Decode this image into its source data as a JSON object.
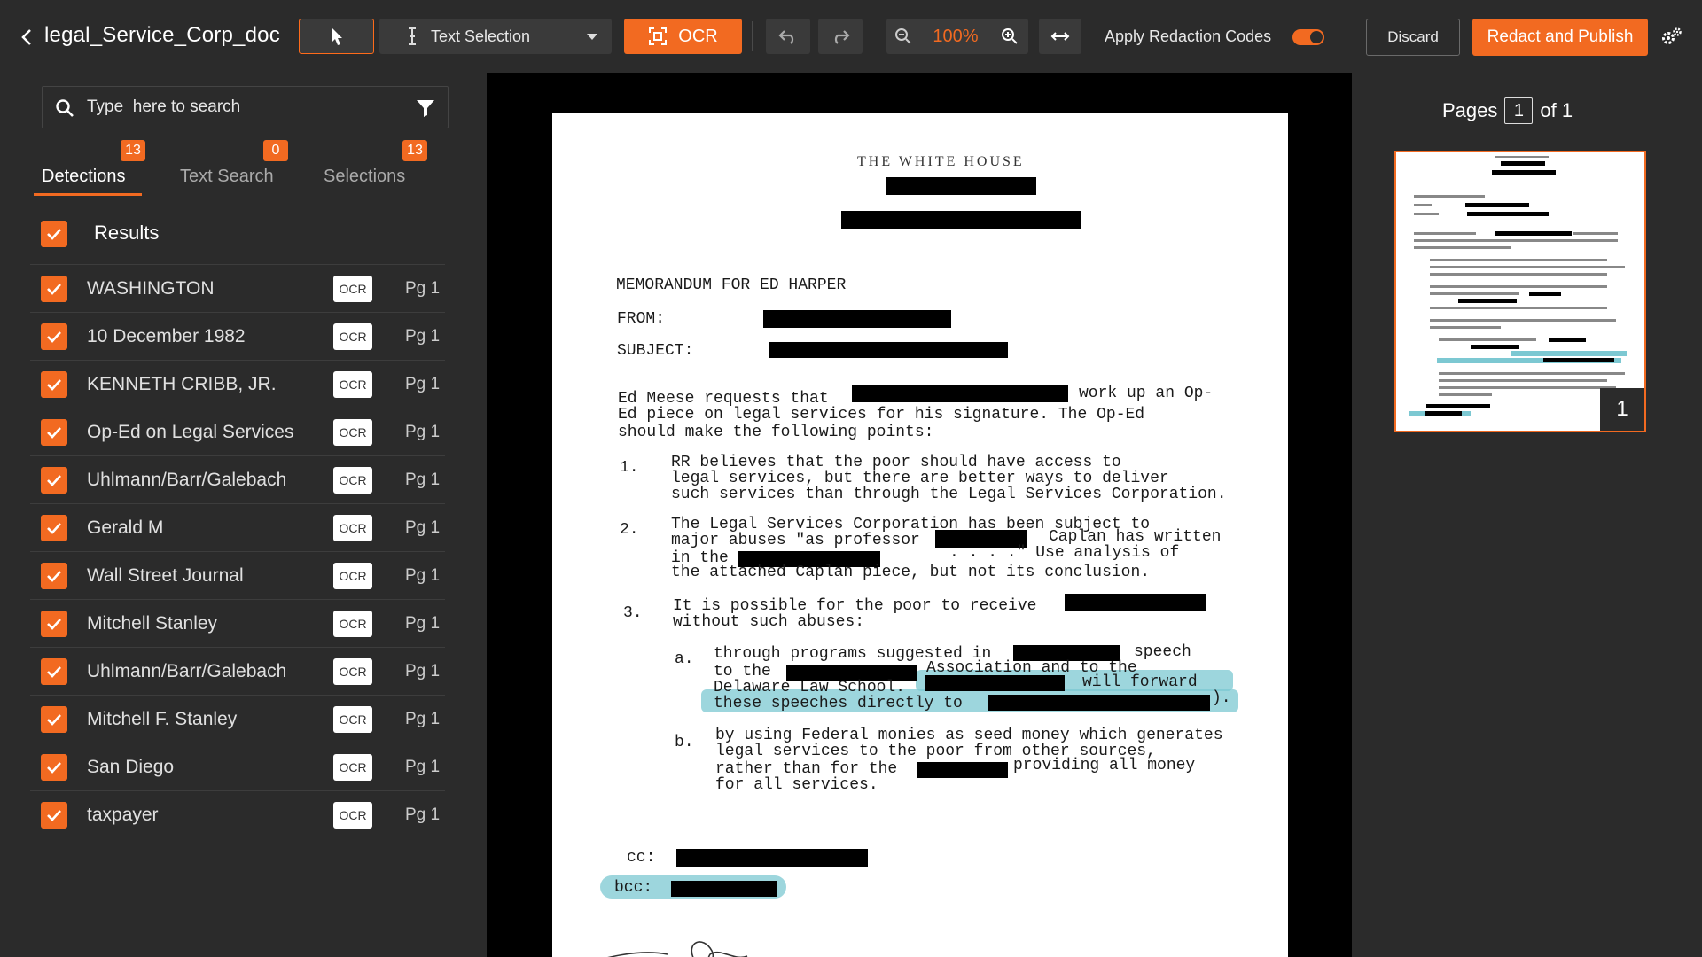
{
  "toolbar": {
    "doc_title": "legal_Service_Corp_doc",
    "mode": "Text Selection",
    "ocr_label": "OCR",
    "zoom": "100%",
    "apply_label": "Apply Redaction Codes",
    "apply_on": true,
    "discard_label": "Discard",
    "publish_label": "Redact and Publish"
  },
  "search": {
    "placeholder": "Type  here to search"
  },
  "tabs": [
    {
      "label": "Detections",
      "count": "13",
      "active": true
    },
    {
      "label": "Text Search",
      "count": "0",
      "active": false
    },
    {
      "label": "Selections",
      "count": "13",
      "active": false
    }
  ],
  "results_label": "Results",
  "detections": [
    {
      "text": "WASHINGTON",
      "tag": "OCR",
      "page": "Pg 1"
    },
    {
      "text": "10 December 1982",
      "tag": "OCR",
      "page": "Pg 1"
    },
    {
      "text": "KENNETH CRIBB, JR.",
      "tag": "OCR",
      "page": "Pg 1"
    },
    {
      "text": "Op-Ed on Legal Services",
      "tag": "OCR",
      "page": "Pg 1"
    },
    {
      "text": "Uhlmann/Barr/Galebach",
      "tag": "OCR",
      "page": "Pg 1"
    },
    {
      "text": "Gerald M",
      "tag": "OCR",
      "page": "Pg 1"
    },
    {
      "text": "Wall Street Journal",
      "tag": "OCR",
      "page": "Pg 1"
    },
    {
      "text": "Mitchell Stanley",
      "tag": "OCR",
      "page": "Pg 1"
    },
    {
      "text": "Uhlmann/Barr/Galebach",
      "tag": "OCR",
      "page": "Pg 1"
    },
    {
      "text": "Mitchell F. Stanley",
      "tag": "OCR",
      "page": "Pg 1"
    },
    {
      "text": "San Diego",
      "tag": "OCR",
      "page": "Pg 1"
    },
    {
      "text": "taxpayer",
      "tag": "OCR",
      "page": "Pg 1"
    }
  ],
  "document": {
    "header": "THE WHITE HOUSE",
    "memo_to": "MEMORANDUM FOR ED HARPER",
    "from_label": "FROM:",
    "subject_label": "SUBJECT:",
    "para1_a": "Ed Meese requests that",
    "para1_b": "work up an Op-",
    "para1_c": "Ed piece on legal services for his signature.  The Op-Ed",
    "para1_d": "should make the following points:",
    "p1_num": "1.",
    "p1_a": "RR believes that the poor should have access to",
    "p1_b": "legal services, but there are better ways to deliver",
    "p1_c": "such services than through the Legal Services Corporation.",
    "p2_num": "2.",
    "p2_a": "The Legal Services Corporation has been subject to",
    "p2_b1": "major abuses \"as professor",
    "p2_b2": "Caplan has written",
    "p2_c1": "in the",
    "p2_c2": ". . . .\"  Use analysis of",
    "p2_d": "the attached Caplan piece, but not its conclusion.",
    "p3_num": "3.",
    "p3_a": "It is possible for the poor to receive",
    "p3_b": "without such abuses:",
    "a_num": "a.",
    "a_1a": "through programs suggested in",
    "a_1b": "speech",
    "a_2a": "to the",
    "a_2b": "Association and to the",
    "a_3a": "Delaware Law School.",
    "a_3b": "will forward",
    "a_4a": "these speeches directly to",
    "a_4b": ").",
    "b_num": "b.",
    "b_1": "by using Federal monies as seed money which generates",
    "b_2": "legal services to the poor from other sources,",
    "b_3a": "rather than for the",
    "b_3b": "providing all money",
    "b_4": "for all services.",
    "cc_label": "cc:",
    "bcc_label": "bcc:"
  },
  "pages": {
    "label": "Pages",
    "current": "1",
    "of_label": "of 1",
    "thumb_number": "1"
  },
  "colors": {
    "accent": "#f26a21",
    "panel": "#2b2b2b",
    "highlight": "#7cc8d2"
  }
}
